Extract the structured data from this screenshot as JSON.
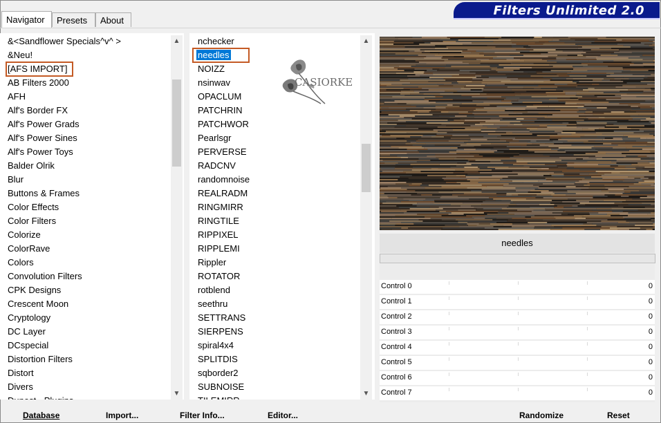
{
  "tabs": [
    "Navigator",
    "Presets",
    "About"
  ],
  "app_title": "Filters Unlimited 2.0",
  "categories": [
    "&<Sandflower Specials^v^ >",
    "&Neu!",
    "[AFS IMPORT]",
    "AB Filters 2000",
    "AFH",
    "Alf's Border FX",
    "Alf's Power Grads",
    "Alf's Power Sines",
    "Alf's Power Toys",
    "Balder Olrik",
    "Blur",
    "Buttons & Frames",
    "Color Effects",
    "Color Filters",
    "Colorize",
    "ColorRave",
    "Colors",
    "Convolution Filters",
    "CPK Designs",
    "Crescent Moon",
    "Cryptology",
    "DC Layer",
    "DCspecial",
    "Distortion Filters",
    "Distort",
    "Divers",
    "Dunest · Plugins"
  ],
  "filters": [
    "nchecker",
    "needles",
    "NOIZZ",
    "nsinwav",
    "OPACLUM",
    "PATCHRIN",
    "PATCHWOR",
    "Pearlsgr",
    "PERVERSE",
    "RADCNV",
    "randomnoise",
    "REALRADM",
    "RINGMIRR",
    "RINGTILE",
    "RIPPIXEL",
    "RIPPLEMI",
    "Rippler",
    "ROTATOR",
    "rotblend",
    "seethru",
    "SETTRANS",
    "SIERPENS",
    "spiral4x4",
    "SPLITDIS",
    "sqborder2",
    "SUBNOISE",
    "TILEMIRR"
  ],
  "selected_filter_name": "needles",
  "controls": [
    {
      "label": "Control 0",
      "value": "0"
    },
    {
      "label": "Control 1",
      "value": "0"
    },
    {
      "label": "Control 2",
      "value": "0"
    },
    {
      "label": "Control 3",
      "value": "0"
    },
    {
      "label": "Control 4",
      "value": "0"
    },
    {
      "label": "Control 5",
      "value": "0"
    },
    {
      "label": "Control 6",
      "value": "0"
    },
    {
      "label": "Control 7",
      "value": "0"
    }
  ],
  "buttons": {
    "database": "Database",
    "import": "Import...",
    "filter_info": "Filter Info...",
    "editor": "Editor...",
    "randomize": "Randomize",
    "reset": "Reset"
  },
  "logo_text": "CASIORKE",
  "colors": {
    "highlight_box": "#c45a24",
    "selection": "#0078d7",
    "banner": "#0a1a8c"
  }
}
